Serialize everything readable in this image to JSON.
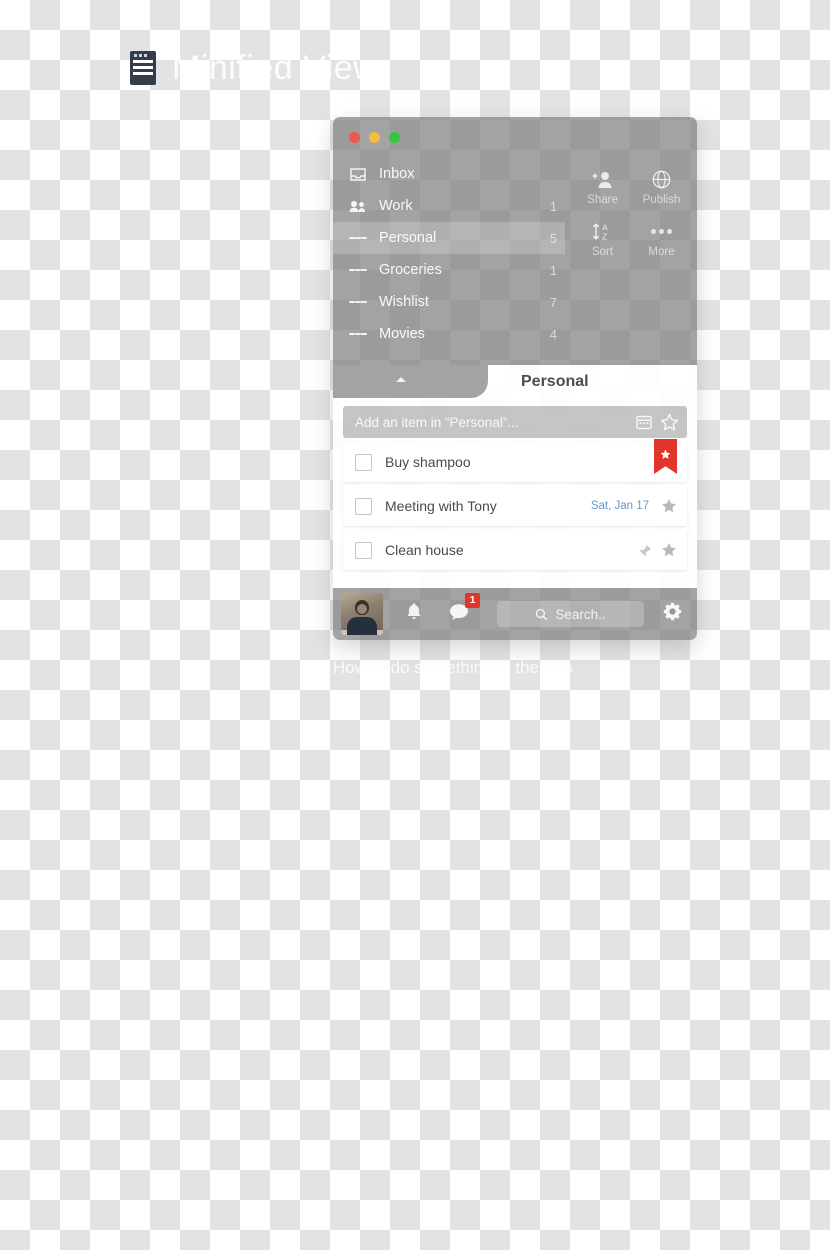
{
  "page": {
    "heading": "Minified View",
    "heading_icon": "note-icon",
    "caption": "How to do something in the lists"
  },
  "window": {
    "traffic_lights": [
      {
        "name": "close",
        "color": "#f05751"
      },
      {
        "name": "minimize",
        "color": "#f6bb42"
      },
      {
        "name": "zoom",
        "color": "#34c642"
      }
    ],
    "sidebar": {
      "items": [
        {
          "label": "Inbox",
          "count": "",
          "icon": "inbox-icon",
          "active": false
        },
        {
          "label": "Work",
          "count": "1",
          "icon": "people-icon",
          "active": false
        },
        {
          "label": "Personal",
          "count": "5",
          "icon": "list-icon",
          "active": true
        },
        {
          "label": "Groceries",
          "count": "1",
          "icon": "list-icon",
          "active": false
        },
        {
          "label": "Wishlist",
          "count": "7",
          "icon": "list-icon",
          "active": false
        },
        {
          "label": "Movies",
          "count": "4",
          "icon": "list-icon",
          "active": false
        }
      ]
    },
    "toolbar": {
      "items": [
        {
          "label": "Share",
          "icon": "person-add-icon"
        },
        {
          "label": "Publish",
          "icon": "globe-icon"
        },
        {
          "label": "Sort",
          "icon": "sort-az-icon"
        },
        {
          "label": "More",
          "icon": "ellipsis-icon"
        }
      ]
    },
    "tabbar": {
      "collapse_icon": "triangle-up-icon",
      "title": "Personal"
    },
    "add_item": {
      "placeholder": "Add an item in “Personal”...",
      "calendar_icon": "calendar-icon",
      "star_icon": "star-outline-icon"
    },
    "tasks": [
      {
        "title": "Buy shampoo",
        "date": "",
        "starred": true,
        "pinned": false,
        "ribbon_color": "#e0352b"
      },
      {
        "title": "Meeting with Tony",
        "date": "Sat, Jan 17",
        "starred": false,
        "pinned": false,
        "date_color": "#5e9bd4"
      },
      {
        "title": "Clean house",
        "date": "",
        "starred": false,
        "pinned": true
      }
    ],
    "bottom_bar": {
      "avatar": "user-avatar",
      "bell_icon": "bell-icon",
      "chat_icon": "chat-bubble-icon",
      "chat_badge": "1",
      "search_placeholder": "Search..",
      "search_icon": "search-icon",
      "gear_icon": "gear-icon"
    }
  }
}
